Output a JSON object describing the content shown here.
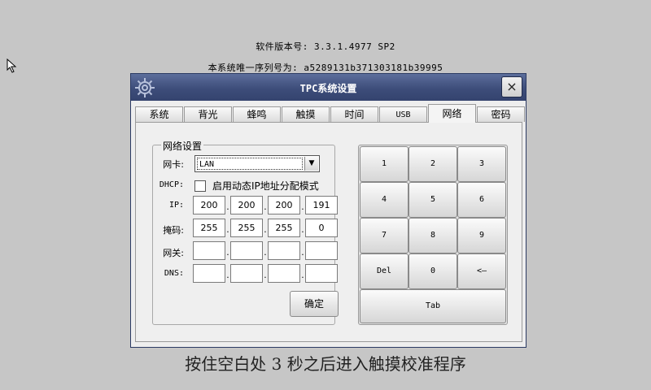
{
  "software_version": "软件版本号: 3.3.1.4977 SP2",
  "serial_number": "本系统唯一序列号为: a5289131b371303181b39995",
  "dialog": {
    "title": "TPC系统设置",
    "close_glyph": "×",
    "tabs": [
      "系统",
      "背光",
      "蜂鸣",
      "触摸",
      "时间",
      "USB",
      "网络",
      "密码"
    ],
    "active_tab": "网络"
  },
  "network": {
    "group_title": "网络设置",
    "nic_label": "网卡:",
    "nic_value": "LAN",
    "dhcp_label": "DHCP:",
    "dhcp_checkbox_label": "启用动态IP地址分配模式",
    "dhcp_checked": false,
    "ip_label": "IP:",
    "ip": [
      "200",
      "200",
      "200",
      "191"
    ],
    "mask_label": "掩码:",
    "mask": [
      "255",
      "255",
      "255",
      "0"
    ],
    "gateway_label": "网关:",
    "gateway": [
      "",
      "",
      "",
      ""
    ],
    "dns_label": "DNS:",
    "dns": [
      "",
      "",
      "",
      ""
    ],
    "confirm_label": "确定"
  },
  "keypad": {
    "keys": [
      "1",
      "2",
      "3",
      "4",
      "5",
      "6",
      "7",
      "8",
      "9",
      "Del",
      "0",
      "<—"
    ],
    "tab_key": "Tab"
  },
  "footer_hint": "按住空白处 3 秒之后进入触摸校准程序",
  "colors": {
    "desktop_bg": "#c6c6c6",
    "titlebar": "#3d4d7a",
    "dialog_bg": "#eeeeee"
  }
}
